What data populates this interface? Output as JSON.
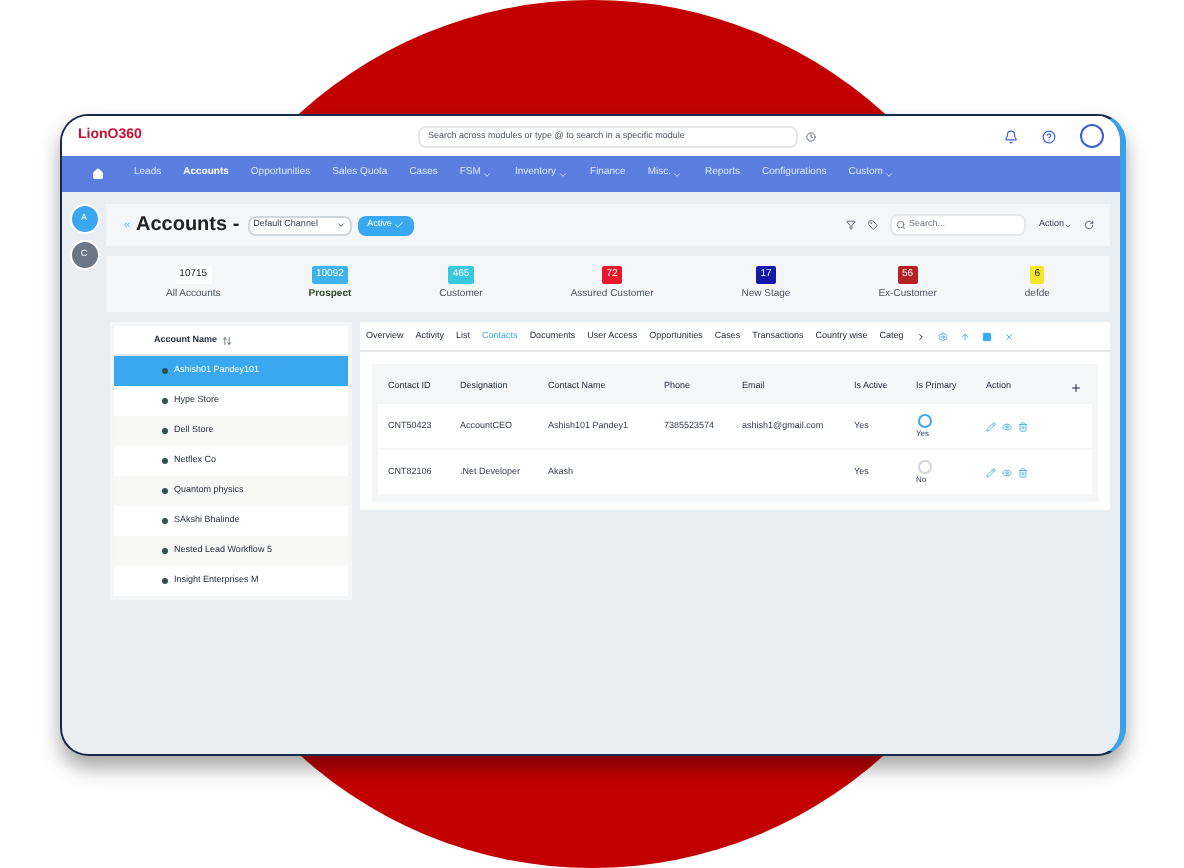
{
  "header": {
    "logo": "LionO360",
    "search": {
      "placeholder": "Search across modules or type @ to search in a specific module"
    }
  },
  "nav": [
    {
      "label": "Leads",
      "selected": false,
      "dropdown": false
    },
    {
      "label": "Accounts",
      "selected": true,
      "dropdown": false
    },
    {
      "label": "Opportunities",
      "selected": false,
      "dropdown": false
    },
    {
      "label": "Sales Quota",
      "selected": false,
      "dropdown": false
    },
    {
      "label": "Cases",
      "selected": false,
      "dropdown": false
    },
    {
      "label": "FSM",
      "selected": false,
      "dropdown": true
    },
    {
      "label": "Inventory",
      "selected": false,
      "dropdown": true
    },
    {
      "label": "Finance",
      "selected": false,
      "dropdown": false
    },
    {
      "label": "Misc.",
      "selected": false,
      "dropdown": true
    },
    {
      "label": "Reports",
      "selected": false,
      "dropdown": false
    },
    {
      "label": "Configurations",
      "selected": false,
      "dropdown": false
    },
    {
      "label": "Custom",
      "selected": false,
      "dropdown": true
    }
  ],
  "rail": [
    {
      "label": "A",
      "color": "#3aa8f0"
    },
    {
      "label": "C",
      "color": "#6b7785"
    }
  ],
  "toolbar": {
    "title": "Accounts -",
    "channel": "Default Channel",
    "status": "Active",
    "search": {
      "placeholder": "Search..."
    },
    "action": "Action"
  },
  "stats": [
    {
      "count": "10715",
      "label": "All Accounts",
      "color": "#ffffff",
      "selected": false
    },
    {
      "count": "10092",
      "label": "Prospect",
      "color": "#3fb3f0",
      "selected": true
    },
    {
      "count": "465",
      "label": "Customer",
      "color": "#38c9e0",
      "selected": false
    },
    {
      "count": "72",
      "label": "Assured Customer",
      "color": "#e8192c",
      "selected": false
    },
    {
      "count": "17",
      "label": "New Stage",
      "color": "#1418a8",
      "selected": false
    },
    {
      "count": "56",
      "label": "Ex-Customer",
      "color": "#b52020",
      "selected": false
    },
    {
      "count": "6",
      "label": "defde",
      "color": "#f5e626",
      "selected": false
    }
  ],
  "accounts": {
    "heading": "Account Name",
    "rows": [
      {
        "name": "Ashish01 Pandey101",
        "selected": true
      },
      {
        "name": "Hype Store",
        "selected": false
      },
      {
        "name": "Dell Store",
        "selected": false
      },
      {
        "name": "Netflex Co",
        "selected": false
      },
      {
        "name": "Quantom physics",
        "selected": false
      },
      {
        "name": "SAkshi Bhalinde",
        "selected": false
      },
      {
        "name": "Nested Lead Workflow 5",
        "selected": false
      },
      {
        "name": "Insight Enterprises M",
        "selected": false
      }
    ]
  },
  "tabs": [
    {
      "label": "Overview",
      "selected": false
    },
    {
      "label": "Activity",
      "selected": false
    },
    {
      "label": "List",
      "selected": false
    },
    {
      "label": "Contacts",
      "selected": true
    },
    {
      "label": "Documents",
      "selected": false
    },
    {
      "label": "User Access",
      "selected": false
    },
    {
      "label": "Opportunities",
      "selected": false
    },
    {
      "label": "Cases",
      "selected": false
    },
    {
      "label": "Transactions",
      "selected": false
    },
    {
      "label": "Country wise",
      "selected": false
    },
    {
      "label": "Categ",
      "selected": false
    }
  ],
  "contacts": {
    "columns": [
      "Contact ID",
      "Designation",
      "Contact Name",
      "Phone",
      "Email",
      "Is Active",
      "Is Primary",
      "Action"
    ],
    "rows": [
      {
        "id": "CNT50423",
        "designation": "AccountCEO",
        "name": "Ashish101 Pandey1",
        "phone": "7385523574",
        "email": "ashish1@gmail.com",
        "active": "Yes",
        "primary": true,
        "primary_label": "Yes"
      },
      {
        "id": "CNT82106",
        "designation": ".Net Developer",
        "name": "Akash",
        "active": "Yes",
        "primary": false,
        "primary_label": "No"
      }
    ]
  }
}
